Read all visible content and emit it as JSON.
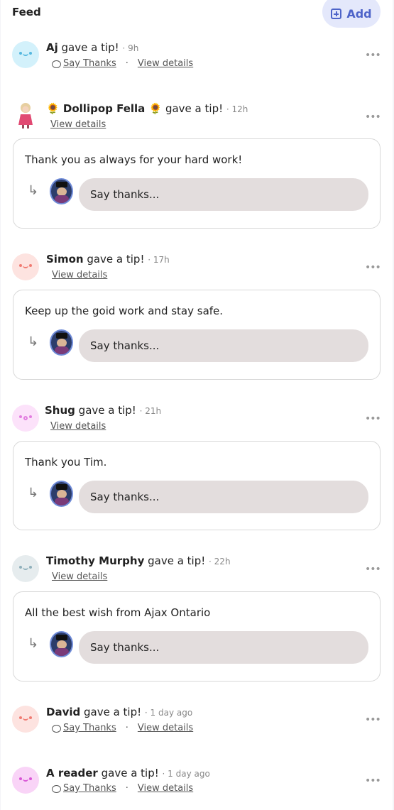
{
  "header": {
    "title": "Feed",
    "add_label": "Add"
  },
  "common": {
    "gave_tip": " gave a tip!",
    "say_thanks": "Say Thanks",
    "view_details": "View details",
    "dot": "·",
    "more": "•••"
  },
  "colors": {
    "accent": "#4e64c9",
    "add_bg": "#e4e8fb",
    "input_bg": "#e3dddd"
  },
  "feed": [
    {
      "name": "Aj",
      "time": "· 9h",
      "avatar_color": "#d3f1fb",
      "has_card": false
    },
    {
      "name": "🌻 Dollipop Fella 🌻",
      "time": "· 12h",
      "avatar": "photo",
      "message": "Thank you as always for your hard work!",
      "reply_placeholder": "Say thanks..."
    },
    {
      "name": "Simon",
      "time": "· 17h",
      "avatar_color": "#fde3e0",
      "message": "Keep up the goid work and stay safe.",
      "reply_placeholder": "Say thanks..."
    },
    {
      "name": "Shug",
      "time": "· 21h",
      "avatar_color": "#fce2fa",
      "message": "Thank you Tim.",
      "reply_placeholder": "Say thanks..."
    },
    {
      "name": "Timothy Murphy",
      "time": "· 22h",
      "avatar_color": "#e6ecee",
      "message": "All the best wish from Ajax Ontario",
      "reply_placeholder": "Say thanks..."
    },
    {
      "name": "David",
      "time": "· 1 day ago",
      "avatar_color": "#fde3e0",
      "has_card": false
    },
    {
      "name": "A reader",
      "time": "· 1 day ago",
      "avatar_color": "#f9d4f7",
      "has_card": false
    }
  ]
}
